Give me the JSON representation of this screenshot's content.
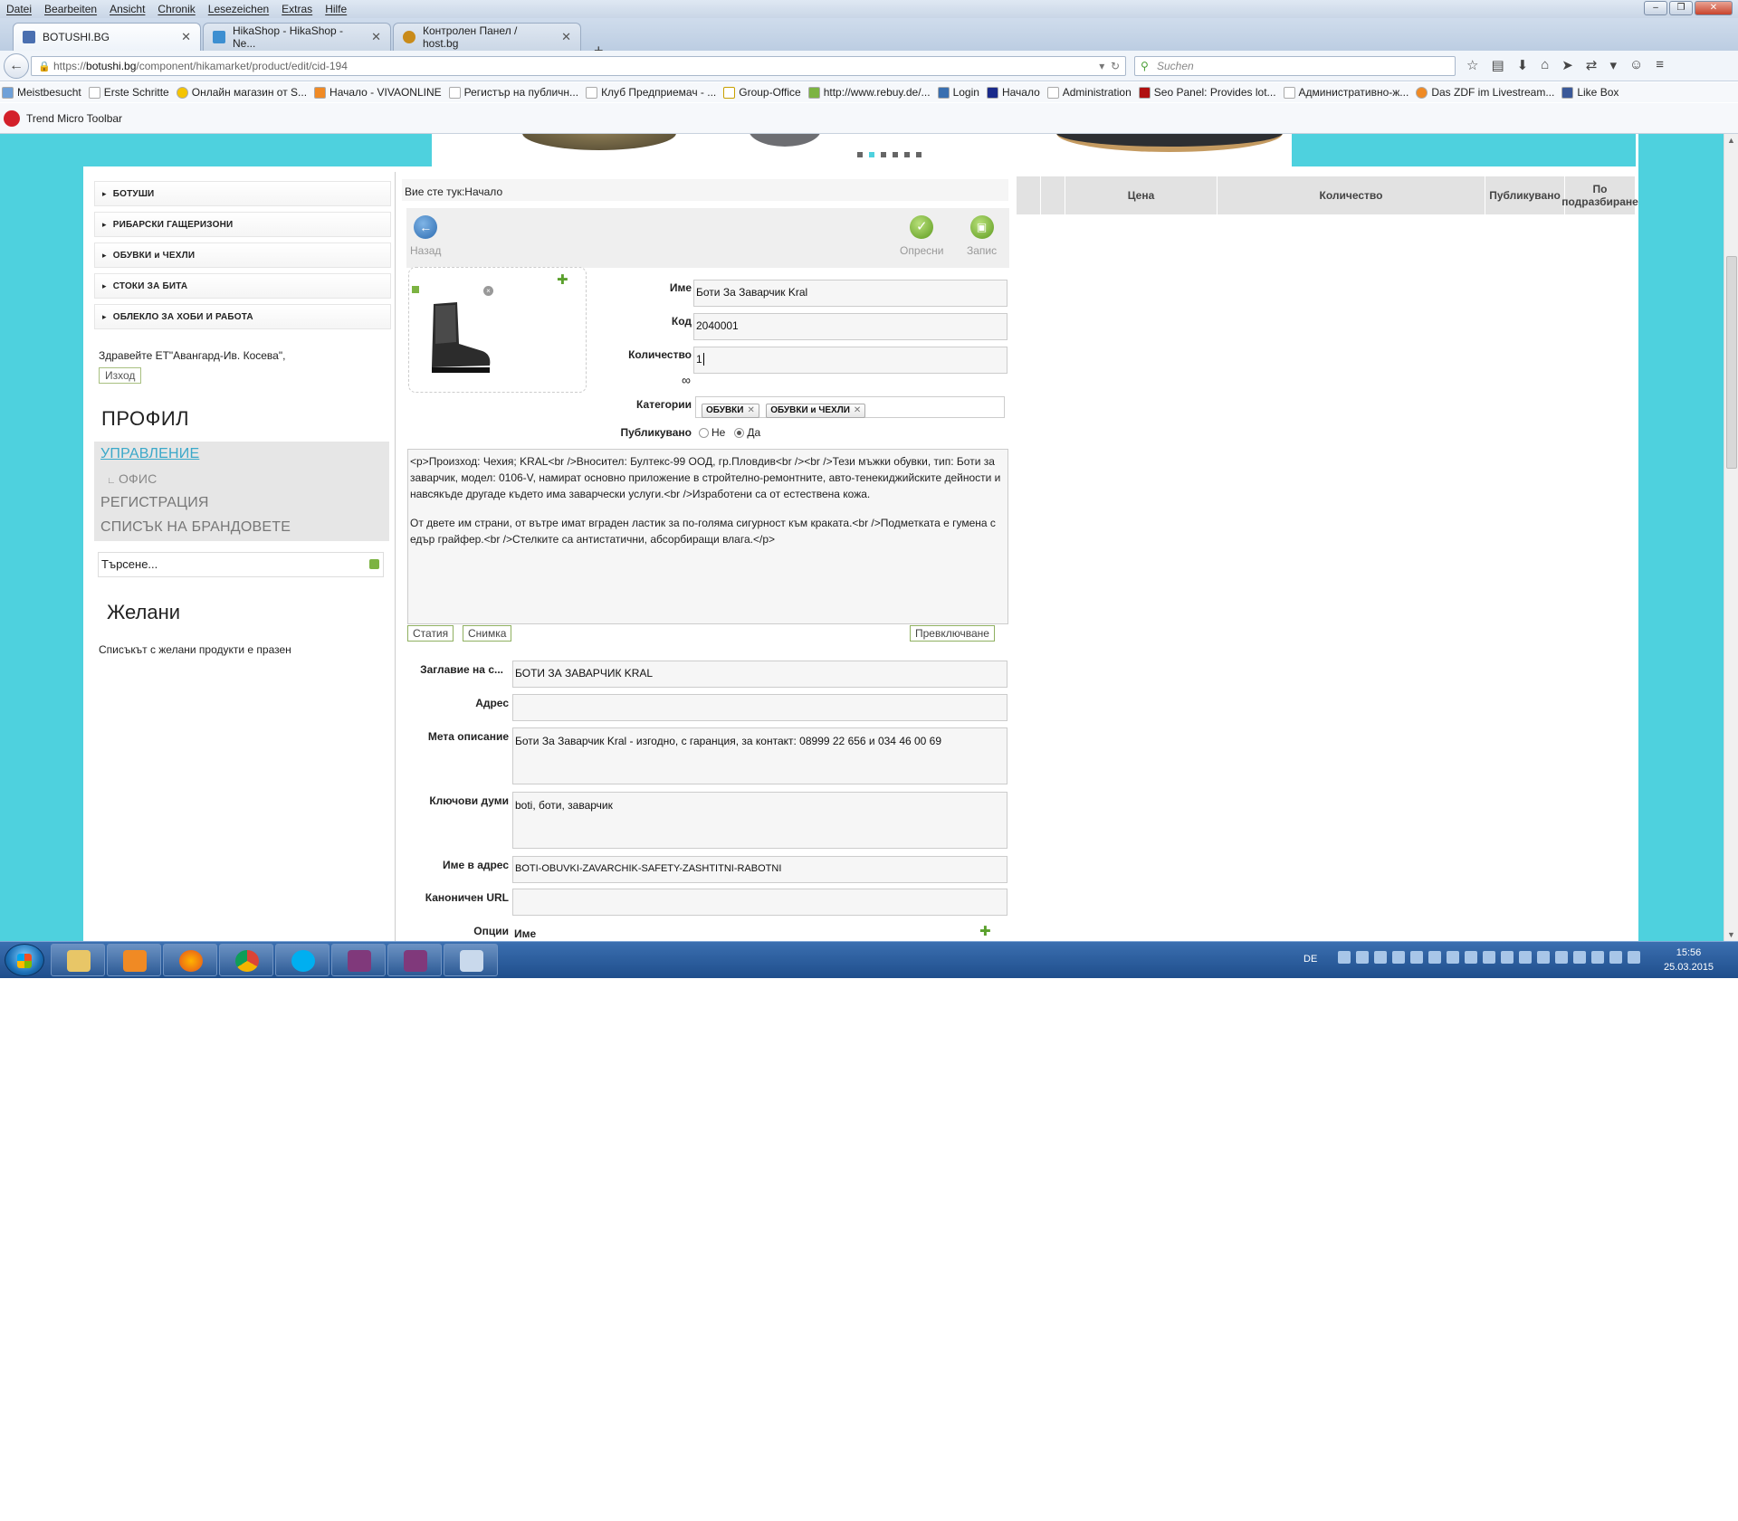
{
  "menubar": [
    "Datei",
    "Bearbeiten",
    "Ansicht",
    "Chronik",
    "Lesezeichen",
    "Extras",
    "Hilfe"
  ],
  "tabs": [
    {
      "label": "BOTUSHI.BG",
      "active": true
    },
    {
      "label": "HikaShop - HikaShop - Ne...",
      "active": false
    },
    {
      "label": "Контролен Панел / host.bg",
      "active": false
    }
  ],
  "url": {
    "prefix": "https://",
    "host": "botushi.bg",
    "path": "/component/hikamarket/product/edit/cid-194"
  },
  "search_placeholder": "Suchen",
  "bookmarks": [
    "Meistbesucht",
    "Erste Schritte",
    "Онлайн магазин от S...",
    "Начало - VIVAONLINE",
    "Регистър на публичн...",
    "Клуб Предприемач - ...",
    "Group-Office",
    "http://www.rebuy.de/...",
    "Login",
    "Начало",
    "Administration",
    "Seo Panel: Provides lot...",
    "Административно-ж...",
    "Das ZDF im Livestream...",
    "Like Box"
  ],
  "trend_toolbar": "Trend Micro Toolbar",
  "categories": [
    "БОТУШИ",
    "РИБАРСКИ ГАЩЕРИЗОНИ",
    "ОБУВКИ и ЧЕХЛИ",
    "СТОКИ ЗА БИТА",
    "ОБЛЕКЛО ЗА ХОБИ И РАБОТА"
  ],
  "welcome": "Здравейте ЕТ\"Авангард-Ив. Косева\",",
  "logout": "Изход",
  "profile_title": "ПРОФИЛ",
  "profile_menu": {
    "manage": "УПРАВЛЕНИЕ",
    "office": "ОФИС",
    "register": "РЕГИСТРАЦИЯ",
    "brands": "СПИСЪК НА БРАНДОВЕТЕ"
  },
  "search_box": "Търсене...",
  "wishlist": {
    "title": "Желани",
    "empty": "Списъкът с желани продукти е празен"
  },
  "breadcrumb": "Вие сте тук:Начало",
  "toolbar": {
    "back": "Назад",
    "refresh": "Опресни",
    "save": "Запис"
  },
  "form": {
    "name_label": "Име",
    "name": "Боти За Заварчик Kral",
    "code_label": "Код",
    "code": "2040001",
    "qty_label": "Количество",
    "qty": "1",
    "qty_infinite": "∞",
    "cat_label": "Категории",
    "cats": [
      "ОБУВКИ",
      "ОБУВКИ и ЧЕХЛИ"
    ],
    "pub_label": "Публикувано",
    "pub_no": "Не",
    "pub_yes": "Да",
    "desc_p1": "<p>Произход: Чехия; KRAL<br />Вносител: Бултекс-99 ООД, гр.Пловдив<br /><br />Тези мъжки обувки, тип: Боти за заварчик, модел: 0106-V, намират основно приложение в стройтелно-ремонтните, авто-тенекиджийските дейности и навсякъде другаде където има заварчески услуги.<br />Изработени са от естествена кожа.",
    "desc_p2": "От двете им страни, от вътре имат вграден ластик за по-голяма сигурност към краката.<br />Подметката е гумена с едър грайфер.<br />Стелките са антистатични, абсорбиращи влага.</p>",
    "btn_article": "Статия",
    "btn_photo": "Снимка",
    "btn_toggle": "Превключване",
    "page_title_label": "Заглавие на с...",
    "page_title": "БОТИ ЗА ЗАВАРЧИК KRAL",
    "address_label": "Адрес",
    "address": "",
    "meta_label": "Мета описание",
    "meta": "Боти За Заварчик Kral - изгодно, с гаранция, за контакт: 08999 22 656 и 034 46 00 69",
    "keywords_label": "Ключови думи",
    "keywords": "boti, боти, заварчик",
    "alias_label": "Име в адрес",
    "alias": "BOTI-OBUVKI-ZAVARCHIK-SAFETY-ZASHTITNI-RABOTNI",
    "canonical_label": "Каноничен URL",
    "canonical": "",
    "options_label": "Опции",
    "options_col": "Име"
  },
  "right_table": [
    "Цена",
    "Количество",
    "Публикувано",
    "По подразбиране"
  ],
  "taskbar": {
    "lang": "DE",
    "time": "15:56",
    "date": "25.03.2015"
  },
  "colors": {
    "page_bg": "#4ed1de",
    "accent_link": "#3aa8c9",
    "taskbar": "#2a5b9a"
  }
}
